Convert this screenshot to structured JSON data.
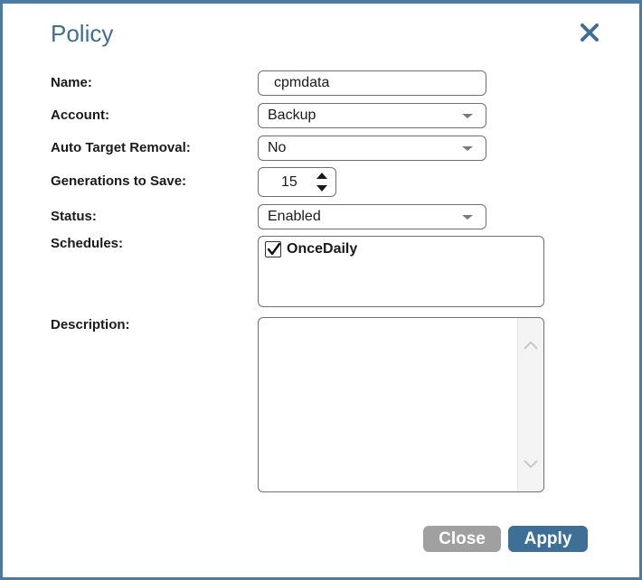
{
  "dialog": {
    "title": "Policy"
  },
  "form": {
    "name_label": "Name:",
    "name_value": "cpmdata",
    "account_label": "Account:",
    "account_value": "Backup",
    "auto_target_label": "Auto Target Removal:",
    "auto_target_value": "No",
    "generations_label": "Generations to Save:",
    "generations_value": "15",
    "status_label": "Status:",
    "status_value": "Enabled",
    "schedules_label": "Schedules:",
    "schedules": [
      {
        "label": "OnceDaily",
        "checked": true
      }
    ],
    "description_label": "Description:",
    "description_value": ""
  },
  "buttons": {
    "close_label": "Close",
    "apply_label": "Apply"
  },
  "colors": {
    "title": "#3f6e95",
    "apply_button": "#3e6f96",
    "close_button": "#a0a0a0",
    "frame_border": "#4a7ba3"
  }
}
